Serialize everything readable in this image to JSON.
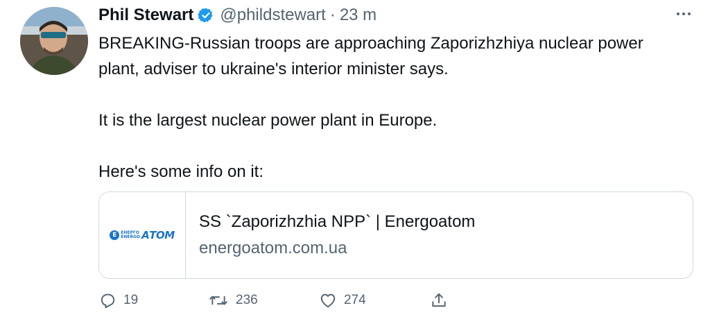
{
  "author": {
    "name": "Phil Stewart",
    "handle": "@phildstewart",
    "separator": "·",
    "time": "23 m",
    "verified": true,
    "avatar_icon": "profile-photo"
  },
  "tweet": {
    "paragraphs": [
      "BREAKING-Russian troops are approaching Zaporizhzhiya nuclear power plant, adviser to ukraine's interior minister says.",
      "It is the largest nuclear power plant in Europe.",
      "Here's some info on it:"
    ]
  },
  "card": {
    "title": "SS `Zaporizhzhia NPP` | Energoatom",
    "domain": "energoatom.com.ua",
    "logo": {
      "circle_letter": "Е",
      "small_top": "ЕНЕРГО",
      "small_bottom": "ENERGO",
      "big": "АТОМ",
      "color": "#1b74c8"
    }
  },
  "actions": {
    "reply": {
      "icon": "reply-icon",
      "count": "19"
    },
    "retweet": {
      "icon": "retweet-icon",
      "count": "236"
    },
    "like": {
      "icon": "heart-icon",
      "count": "274"
    },
    "share": {
      "icon": "share-icon"
    }
  },
  "colors": {
    "text": "#0f1419",
    "secondary": "#536471",
    "verified": "#1d9bf0",
    "border": "#cfd9de"
  }
}
